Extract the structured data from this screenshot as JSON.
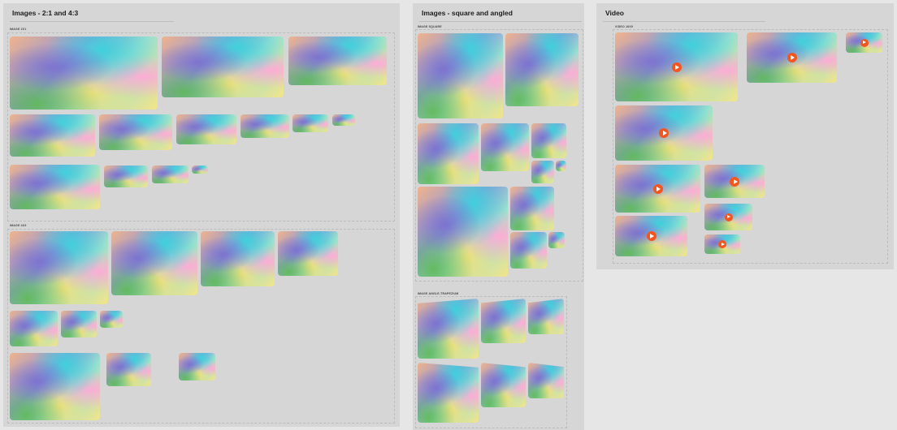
{
  "panels": {
    "images_ratio": {
      "title": "Images - 2:1 and 4:3",
      "groups": [
        {
          "label": "Image 2x1"
        },
        {
          "label": "Image 4x3"
        }
      ]
    },
    "images_square": {
      "title": "Images - square and angled",
      "groups": [
        {
          "label": "Image square"
        },
        {
          "label": "Image angle-trapezium"
        }
      ]
    },
    "video": {
      "title": "Video",
      "groups": [
        {
          "label": "Video 16x9"
        }
      ]
    }
  }
}
